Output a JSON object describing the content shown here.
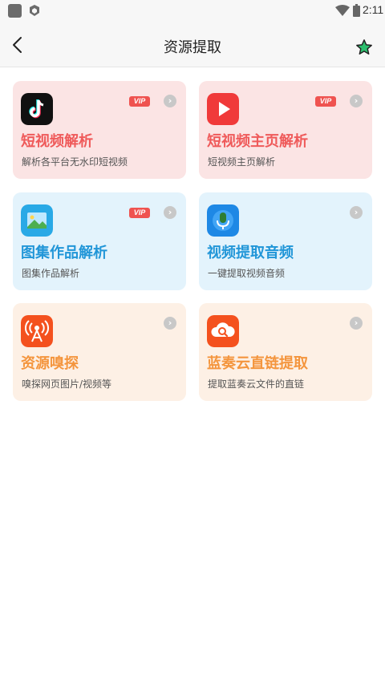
{
  "status_bar": {
    "time": "2:11"
  },
  "header": {
    "title": "资源提取"
  },
  "cards": [
    {
      "title": "短视频解析",
      "subtitle": "解析各平台无水印短视频",
      "vip": "VIP",
      "icon": "tiktok-icon"
    },
    {
      "title": "短视频主页解析",
      "subtitle": "短视频主页解析",
      "vip": "VIP",
      "icon": "play-icon"
    },
    {
      "title": "图集作品解析",
      "subtitle": "图集作品解析",
      "vip": "VIP",
      "icon": "image-gallery-icon"
    },
    {
      "title": "视频提取音频",
      "subtitle": "一键提取视频音频",
      "icon": "microphone-icon"
    },
    {
      "title": "资源嗅探",
      "subtitle": "嗅探网页图片/视频等",
      "icon": "broadcast-icon"
    },
    {
      "title": "蓝奏云直链提取",
      "subtitle": "提取蓝奏云文件的直链",
      "icon": "cloud-search-icon"
    }
  ],
  "colors": {
    "pink_bg": "#fbe4e4",
    "pink_title": "#ef5a5a",
    "blue_bg": "#e3f3fc",
    "blue_title": "#2196d8",
    "orange_bg": "#fdf0e5",
    "orange_title": "#f4953d",
    "vip_badge": "#ef5350"
  }
}
